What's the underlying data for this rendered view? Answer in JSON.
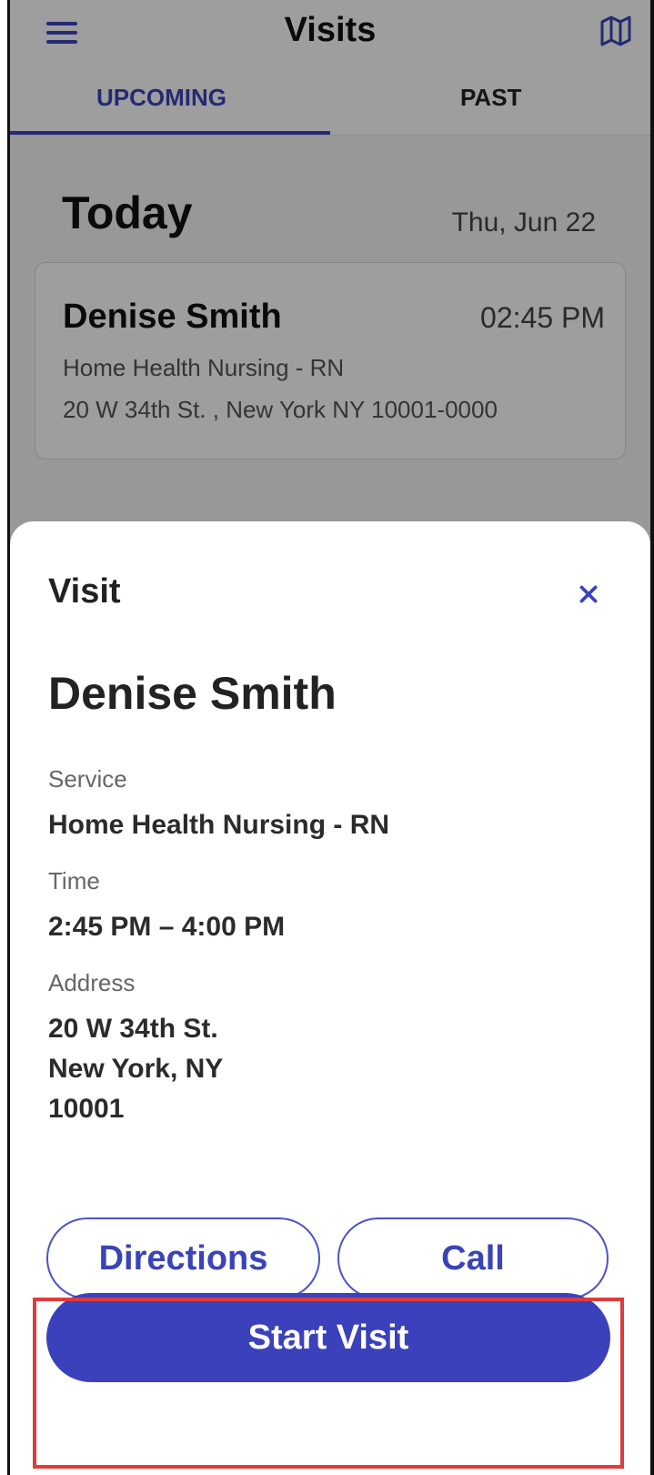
{
  "header": {
    "title": "Visits",
    "menu_icon": "hamburger-menu-icon",
    "map_icon": "map-icon"
  },
  "tabs": [
    {
      "label": "UPCOMING",
      "active": true
    },
    {
      "label": "PAST",
      "active": false
    }
  ],
  "schedule": {
    "heading": "Today",
    "date": "Thu, Jun 22",
    "visit": {
      "patient": "Denise Smith",
      "time": "02:45 PM",
      "service": "Home Health Nursing - RN",
      "address": "20 W 34th St. , New York NY 10001-0000"
    }
  },
  "sheet": {
    "title": "Visit",
    "close_icon": "close-icon",
    "patient": "Denise Smith",
    "service_label": "Service",
    "service_value": "Home Health Nursing - RN",
    "time_label": "Time",
    "time_value": "2:45 PM – 4:00 PM",
    "address_label": "Address",
    "address_line1": "20 W 34th St.",
    "address_line2": "New York, NY",
    "address_line3": "10001",
    "directions_label": "Directions",
    "call_label": "Call",
    "start_label": "Start Visit"
  },
  "colors": {
    "accent": "#3a44b8",
    "primary_button": "#3b41bb",
    "highlight": "#e03b3b"
  }
}
